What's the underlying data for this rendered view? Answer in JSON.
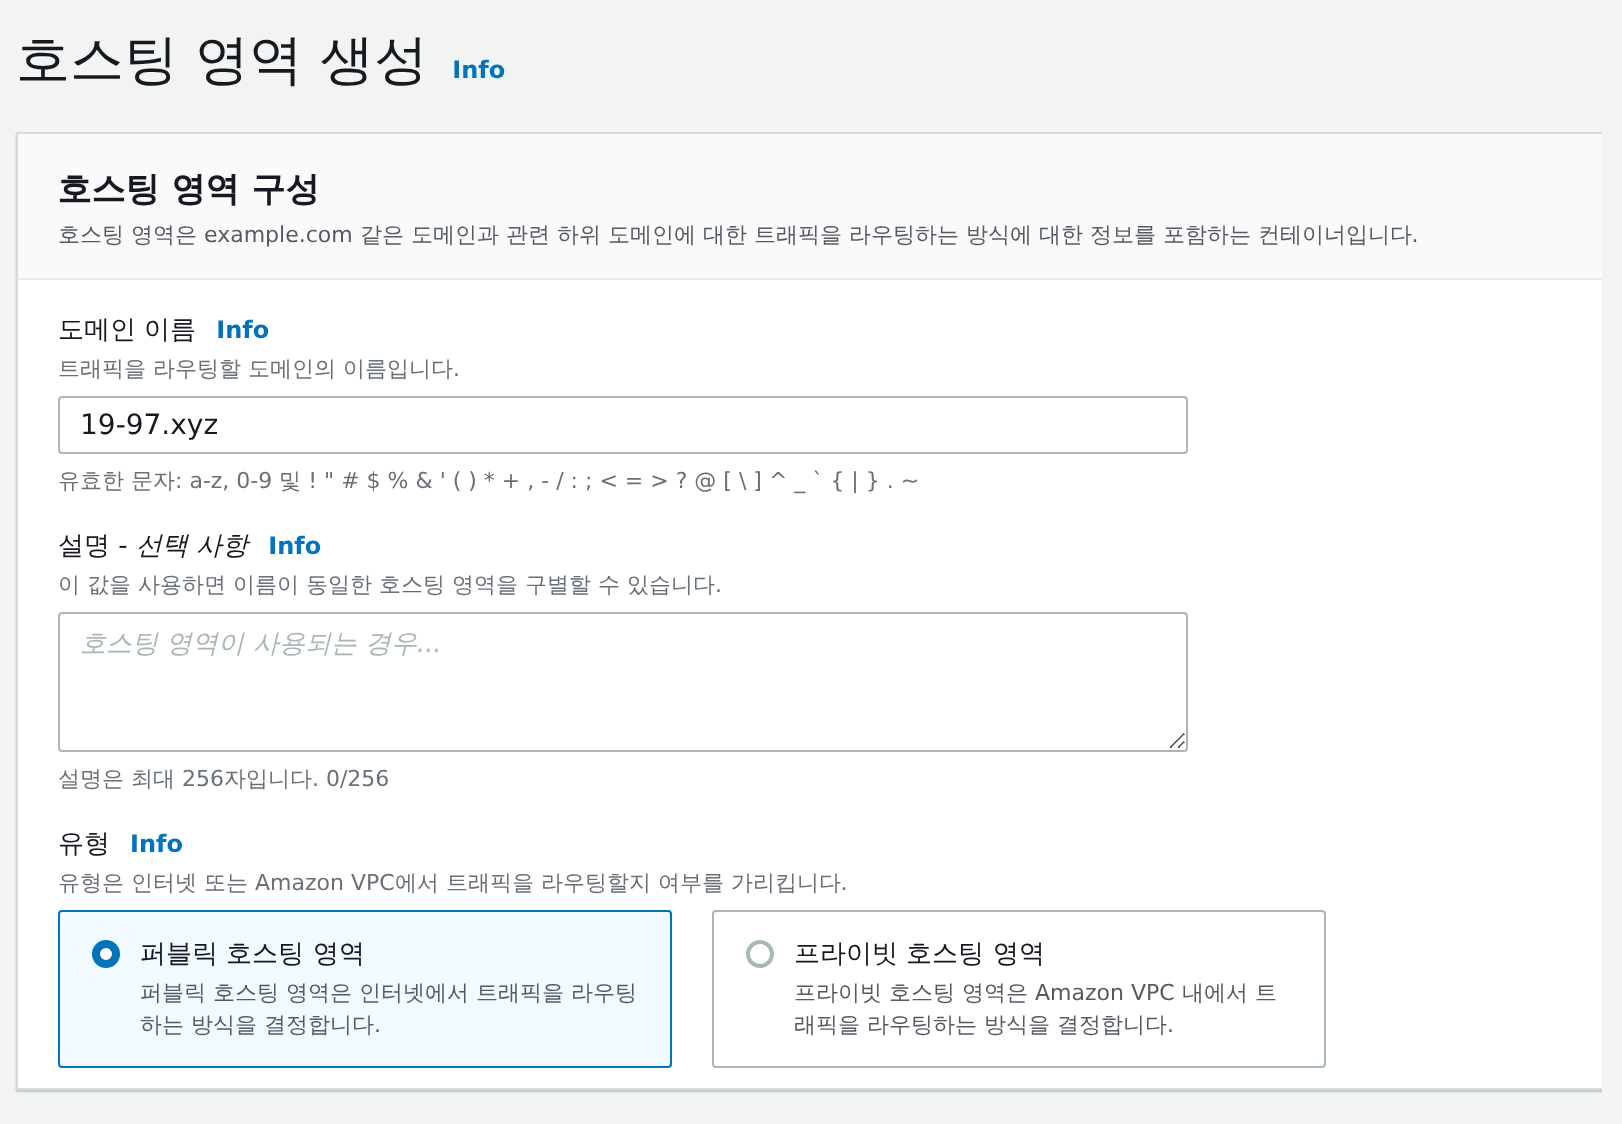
{
  "page": {
    "title": "호스팅 영역 생성",
    "info": "Info"
  },
  "panel": {
    "title": "호스팅 영역 구성",
    "description": "호스팅 영역은 example.com 같은 도메인과 관련 하위 도메인에 대한 트래픽을 라우팅하는 방식에 대한 정보를 포함하는 컨테이너입니다."
  },
  "domain": {
    "label": "도메인 이름",
    "info": "Info",
    "hint": "트래픽을 라우팅할 도메인의 이름입니다.",
    "value": "19-97.xyz",
    "constraint": "유효한 문자: a-z, 0-9 및 ! \" # $ % & ' ( ) * + , - / : ; < = > ? @ [ \\ ] ^ _ ` { | } . ~"
  },
  "description": {
    "label": "설명 - *선택 사항*",
    "info": "Info",
    "hint": "이 값을 사용하면 이름이 동일한 호스팅 영역을 구별할 수 있습니다.",
    "placeholder": "호스팅 영역이 사용되는 경우...",
    "constraint": "설명은 최대 256자입니다. 0/256"
  },
  "type": {
    "label": "유형",
    "info": "Info",
    "hint": "유형은 인터넷 또는 Amazon VPC에서 트래픽을 라우팅할지 여부를 가리킵니다.",
    "options": [
      {
        "title": "퍼블릭 호스팅 영역",
        "description": "퍼블릭 호스팅 영역은 인터넷에서 트래픽을 라우팅하는 방식을 결정합니다.",
        "selected": true
      },
      {
        "title": "프라이빗 호스팅 영역",
        "description": "프라이빗 호스팅 영역은 Amazon VPC 내에서 트래픽을 라우팅하는 방식을 결정합니다.",
        "selected": false
      }
    ]
  }
}
